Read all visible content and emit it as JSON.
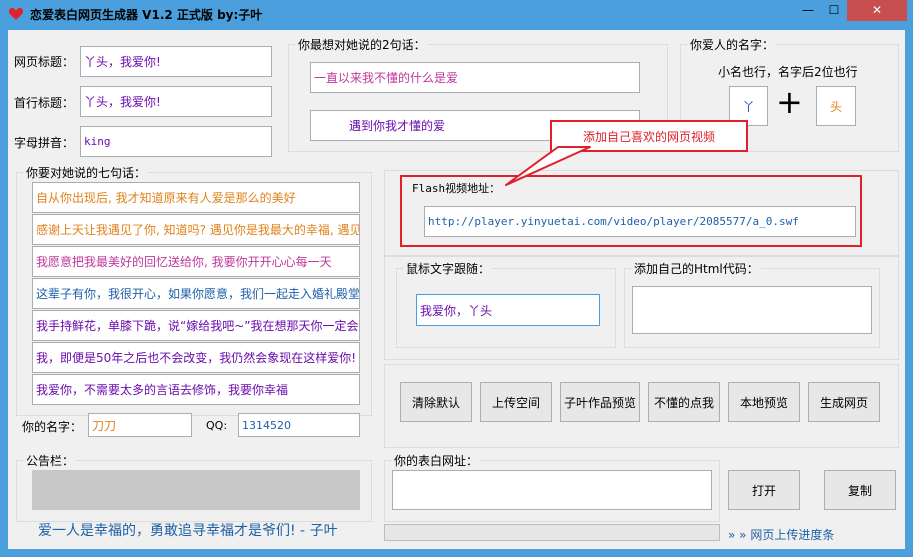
{
  "window": {
    "title": "恋爱表白网页生成器 V1.2 正式版  by:子叶",
    "min": "—",
    "max": "☐",
    "close": "✕"
  },
  "left": {
    "page_title_label": "网页标题：",
    "page_title_value": "丫头，我爱你!",
    "first_title_label": "首行标题：",
    "first_title_value": "丫头，我爱你!",
    "pinyin_label": "字母拼音：",
    "pinyin_value": "king"
  },
  "two_lines": {
    "group_title": "你最想对她说的2句话：",
    "line1": "一直以来我不懂的什么是爱",
    "line2": "遇到你我才懂的爱"
  },
  "names": {
    "group_title": "你爱人的名字：",
    "hint": "小名也行，名字后2位也行",
    "name1": "丫",
    "plus": "+",
    "name2": "头"
  },
  "seven_lines": {
    "group_title": "你要对她说的七句话：",
    "lines": [
      "自从你出现后, 我才知道原来有人爱是那么的美好",
      "感谢上天让我遇见了你, 知道吗? 遇见你是我最大的幸福, 遇见",
      "我愿意把我最美好的回忆送给你, 我要你开开心心每一天",
      "这辈子有你，我很开心，如果你愿意，我们一起走入婚礼殿堂",
      "我手持鲜花，单膝下跪，说“嫁给我吧~”我在想那天你一定会",
      "我，即便是50年之后也不会改变，我仍然会象现在这样爱你!",
      "我爱你，不需要太多的言语去修饰，我要你幸福"
    ],
    "colors": [
      "#e0821b",
      "#e0821b",
      "#c0389b",
      "#1f5fa8",
      "#6a0dad",
      "#6a0dad",
      "#6a0dad"
    ]
  },
  "your_name": {
    "label": "你的名字：",
    "value": "刀刀",
    "qq_label": "QQ:",
    "qq_value": "1314520"
  },
  "notice": {
    "group_title": "公告栏："
  },
  "slogan": "爱一人是幸福的，勇敢追寻幸福才是爷们!  - 子叶",
  "flash": {
    "label": "Flash视频地址：",
    "value": "http://player.yinyuetai.com/video/player/2085577/a_0.swf",
    "callout": "添加自己喜欢的网页视频"
  },
  "mouse_text": {
    "group_title": "鼠标文字跟随：",
    "value": "我爱你，丫头"
  },
  "html_code": {
    "group_title": "添加自己的Html代码：",
    "value": ""
  },
  "buttons": {
    "clear": "清除默认",
    "upload": "上传空间",
    "preview_works": "子叶作品预览",
    "help": "不懂的点我",
    "local_preview": "本地预览",
    "generate": "生成网页"
  },
  "url": {
    "group_title": "你的表白网址：",
    "value": "",
    "open": "打开",
    "copy": "复制"
  },
  "progress": {
    "label": "» » 网页上传进度条",
    "percent": 0
  }
}
